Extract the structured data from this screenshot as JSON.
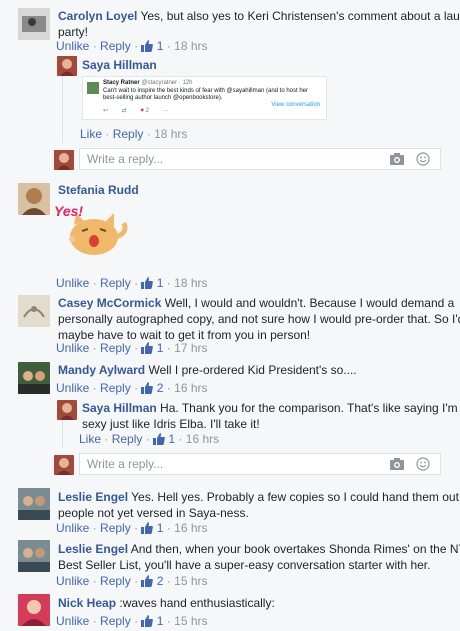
{
  "comments": [
    {
      "author": "Carolyn Loyel",
      "text_line1": "Yes, but also yes to Keri Christensen's comment about a launch",
      "text_line2": "party!",
      "actions": {
        "like": "Unlike",
        "reply": "Reply",
        "count": "1",
        "time": "18 hrs"
      }
    },
    {
      "author": "Stefania Rudd",
      "sticker": "Yes!",
      "actions": {
        "like": "Unlike",
        "reply": "Reply",
        "count": "1",
        "time": "18 hrs"
      }
    },
    {
      "author": "Casey McCormick",
      "text_line1": "Well, I would and wouldn't. Because I would demand a",
      "text_line2": "personally autographed copy, and not sure how I would pre-order that. So I'd",
      "text_line3": "maybe have to wait to get it from you in person!",
      "actions": {
        "like": "Unlike",
        "reply": "Reply",
        "count": "1",
        "time": "17 hrs"
      }
    },
    {
      "author": "Mandy Aylward",
      "text_line1": "Well I pre-ordered Kid President's so....",
      "actions": {
        "like": "Unlike",
        "reply": "Reply",
        "count": "2",
        "time": "16 hrs"
      }
    },
    {
      "author": "Leslie Engel",
      "text_line1": "Yes. Hell yes. Probably a few copies so I could hand them out to",
      "text_line2": "people not yet versed in Saya-ness.",
      "actions": {
        "like": "Unlike",
        "reply": "Reply",
        "count": "1",
        "time": "16 hrs"
      }
    },
    {
      "author": "Leslie Engel",
      "text_line1": "And then, when your book overtakes Shonda Rimes' on the NYT",
      "text_line2": "Best Seller List, you'll have a super-easy conversation starter with her.",
      "actions": {
        "like": "Unlike",
        "reply": "Reply",
        "count": "2",
        "time": "15 hrs"
      }
    },
    {
      "author": "Nick Heap",
      "text_line1": ":waves hand enthusiastically:",
      "actions": {
        "like": "Unlike",
        "reply": "Reply",
        "count": "1",
        "time": "15 hrs"
      }
    }
  ],
  "replies": [
    {
      "author": "Saya Hillman",
      "embed": {
        "author": "Stacy Ratner",
        "handle": "@stacyratner · 12h",
        "line1": "Can't wait to inspire the best kinds of fear with @sayahillman (and to host her",
        "line2": "best-selling author launch @openbookstore).",
        "view": "View conversation",
        "likes": "2"
      },
      "actions": {
        "like": "Like",
        "reply": "Reply",
        "time": "18 hrs"
      }
    },
    {
      "author": "Saya Hillman",
      "text_line1": "Ha. Thank you for the comparison. That's like saying I'm",
      "text_line2": "sexy just like Idris Elba. I'll take it!",
      "actions": {
        "like": "Like",
        "reply": "Reply",
        "count": "1",
        "time": "16 hrs"
      }
    }
  ],
  "reply_box": {
    "placeholder": "Write a reply..."
  },
  "icons": {
    "camera": "camera-icon",
    "emoji": "emoji-icon",
    "like": "thumbs-up-icon"
  },
  "colors": {
    "link": "#365899",
    "action": "#4267b2",
    "meta": "#90949c",
    "bg": "#f6f7f9"
  }
}
